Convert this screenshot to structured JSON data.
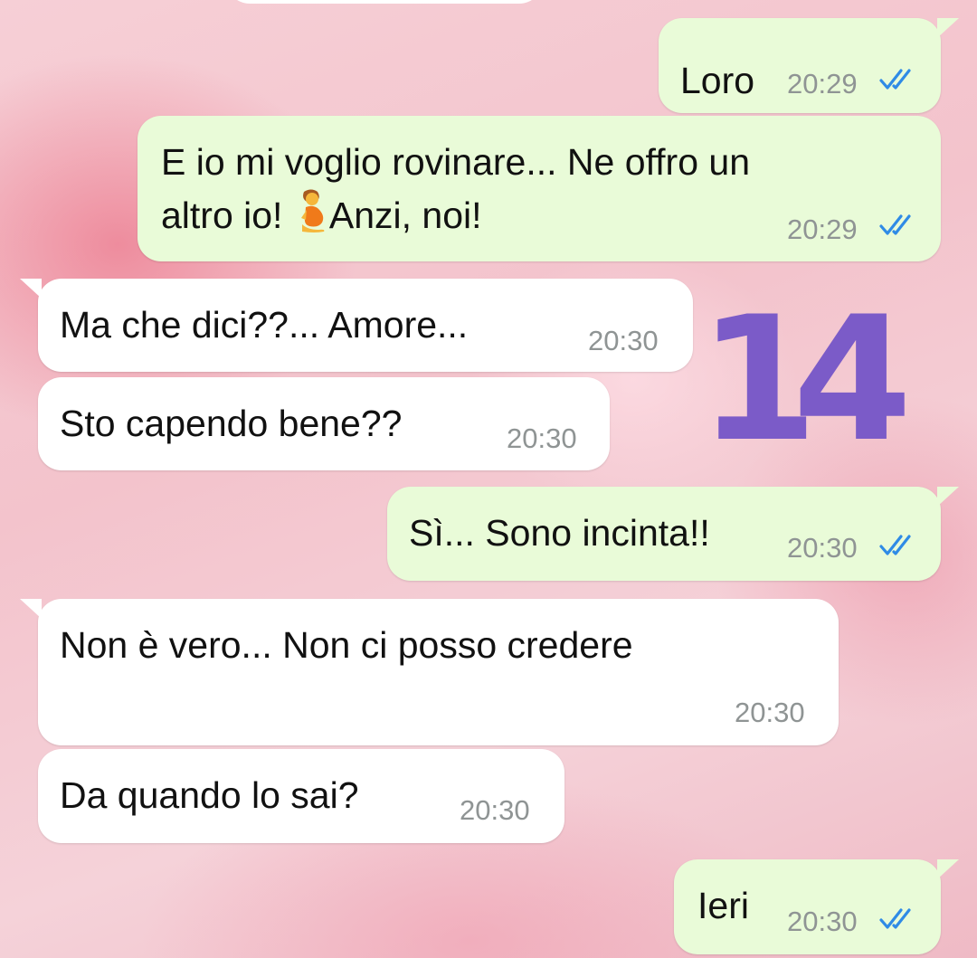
{
  "badge": {
    "label": "14",
    "color": "#7b5bc8"
  },
  "messages": [
    {
      "direction": "outgoing",
      "text": "Loro",
      "time": "20:29",
      "status": "read"
    },
    {
      "direction": "outgoing",
      "lines": [
        "E io mi voglio rovinare... Ne offro un",
        "altro io!",
        "Anzi, noi!"
      ],
      "emoji": "pregnant-person-emoji",
      "time": "20:29",
      "status": "read"
    },
    {
      "direction": "incoming",
      "text": "Ma che dici??... Amore...",
      "time": "20:30"
    },
    {
      "direction": "incoming",
      "text": "Sto capendo bene??",
      "time": "20:30"
    },
    {
      "direction": "outgoing",
      "text": "Sì... Sono incinta!!",
      "time": "20:30",
      "status": "read"
    },
    {
      "direction": "incoming",
      "text": "Non è vero... Non ci posso credere",
      "time": "20:30"
    },
    {
      "direction": "incoming",
      "text": "Da quando lo sai?",
      "time": "20:30"
    },
    {
      "direction": "outgoing",
      "text": "Ieri",
      "time": "20:30",
      "status": "read"
    }
  ],
  "colors": {
    "outgoing_bubble": "#e9fbd8",
    "incoming_bubble": "#ffffff",
    "read_ticks": "#2f8be6",
    "timestamp": "#8f9494"
  }
}
